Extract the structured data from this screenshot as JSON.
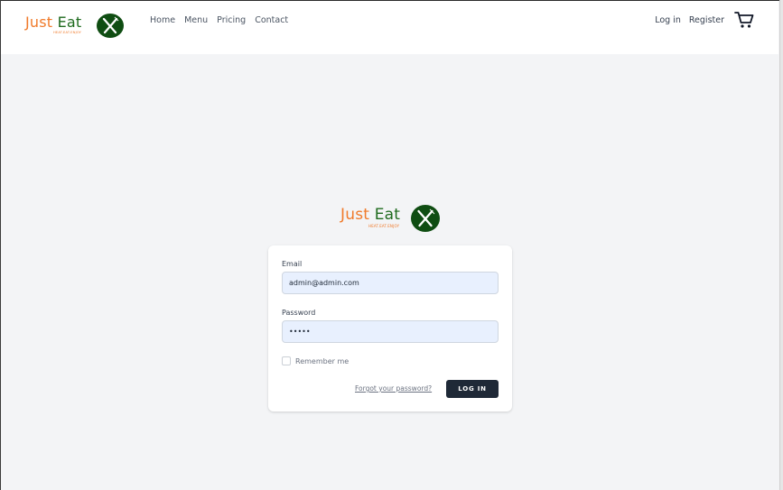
{
  "brand": {
    "name_first": "Just",
    "name_second": "Eat",
    "tagline": "HEAT.EAT.ENJOY",
    "colors": {
      "orange": "#f07a2a",
      "green": "#1f6b1f",
      "badge": "#0f4d12"
    }
  },
  "nav": {
    "links": [
      "Home",
      "Menu",
      "Pricing",
      "Contact"
    ],
    "login": "Log in",
    "register": "Register",
    "cart_icon": "cart-icon"
  },
  "form": {
    "email_label": "Email",
    "email_value": "admin@admin.com",
    "password_label": "Password",
    "password_value": "•••••",
    "remember_label": "Remember me",
    "forgot_link": "Forgot your password?",
    "submit_label": "LOG IN"
  },
  "colors": {
    "page_bg": "#f3f4f6",
    "input_bg": "#e8f0fe",
    "button_bg": "#1f2937"
  }
}
